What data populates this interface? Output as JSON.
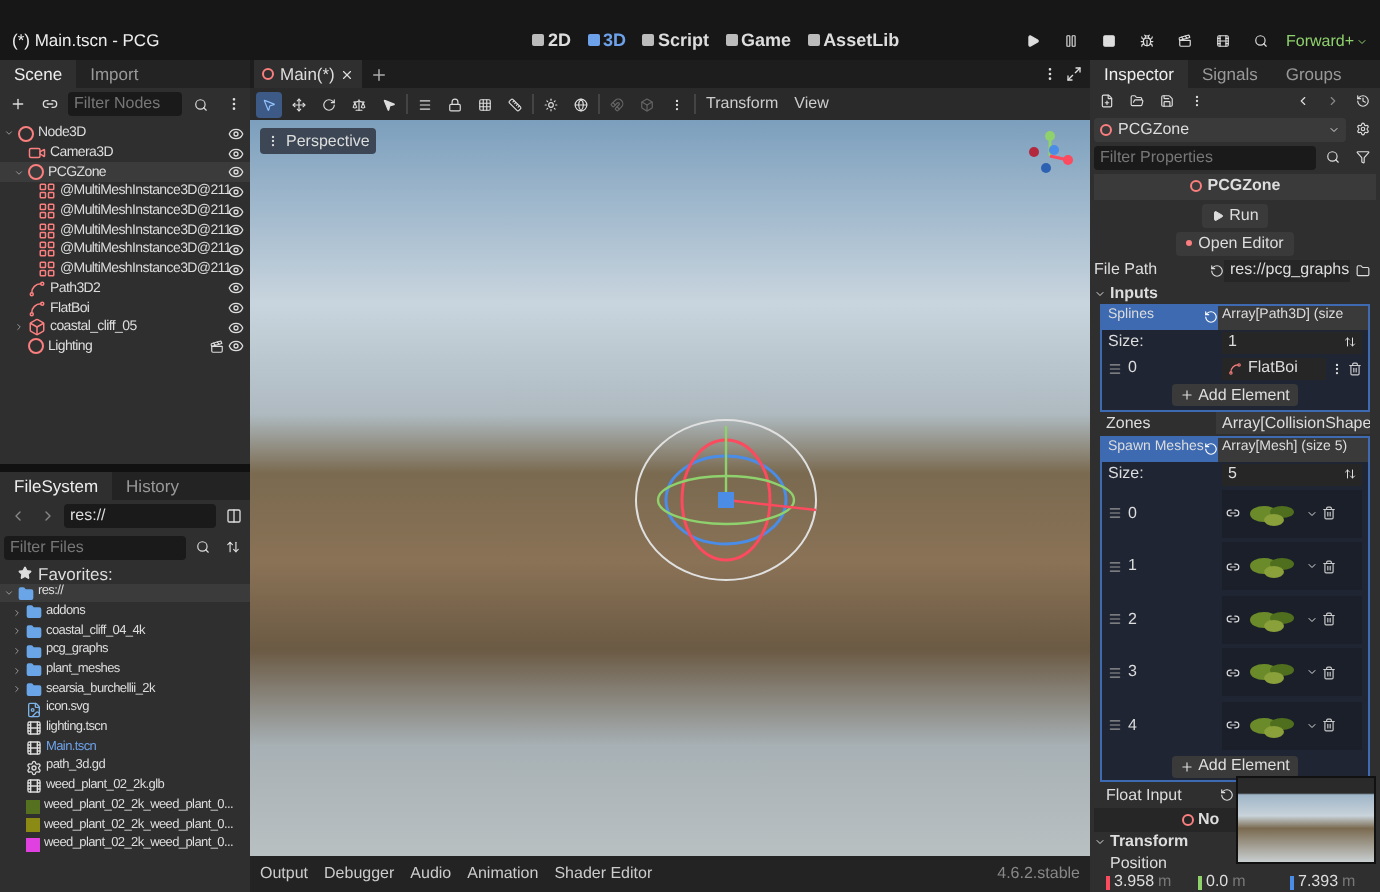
{
  "window": {
    "title": "(*) Main.tscn - PCG"
  },
  "main_screens": [
    {
      "label": "2D",
      "selected": false
    },
    {
      "label": "3D",
      "selected": true
    },
    {
      "label": "Script",
      "selected": false
    },
    {
      "label": "Game",
      "selected": false
    },
    {
      "label": "AssetLib",
      "selected": false
    }
  ],
  "renderer": "Forward+",
  "scene_dock": {
    "tabs": [
      {
        "label": "Scene",
        "selected": true
      },
      {
        "label": "Import",
        "selected": false
      }
    ],
    "filter_placeholder": "Filter Nodes",
    "tree": [
      {
        "label": "Node3D",
        "kind": "node3d",
        "selected": false,
        "expanded": true,
        "children": [
          {
            "label": "Camera3D",
            "kind": "camera",
            "selected": false
          },
          {
            "label": "PCGZone",
            "kind": "node3d",
            "selected": true,
            "expanded": true,
            "children": [
              {
                "label": "@MultiMeshInstance3D@211",
                "kind": "multimesh",
                "selected": false
              },
              {
                "label": "@MultiMeshInstance3D@211",
                "kind": "multimesh",
                "selected": false
              },
              {
                "label": "@MultiMeshInstance3D@211",
                "kind": "multimesh",
                "selected": false
              },
              {
                "label": "@MultiMeshInstance3D@211",
                "kind": "multimesh",
                "selected": false
              },
              {
                "label": "@MultiMeshInstance3D@211",
                "kind": "multimesh",
                "selected": false
              }
            ]
          },
          {
            "label": "Path3D2",
            "kind": "path",
            "selected": false
          },
          {
            "label": "FlatBoi",
            "kind": "path",
            "selected": false
          },
          {
            "label": "coastal_cliff_05",
            "kind": "mesh",
            "selected": false,
            "expanded": false
          },
          {
            "label": "Lighting",
            "kind": "lighting",
            "selected": false
          }
        ]
      }
    ]
  },
  "filesystem": {
    "tabs": [
      {
        "label": "FileSystem",
        "selected": true
      },
      {
        "label": "History",
        "selected": false
      }
    ],
    "path": "res://",
    "filter_placeholder": "Filter Files",
    "favorites": "Favorites:",
    "tree": [
      {
        "label": "res://",
        "kind": "folder",
        "selected": true,
        "expanded": true,
        "children": [
          {
            "label": "addons",
            "kind": "folder",
            "selected": false,
            "expanded": false
          },
          {
            "label": "coastal_cliff_04_4k",
            "kind": "folder",
            "selected": false,
            "expanded": false
          },
          {
            "label": "pcg_graphs",
            "kind": "folder",
            "selected": false,
            "expanded": false
          },
          {
            "label": "plant_meshes",
            "kind": "folder",
            "selected": false,
            "expanded": false
          },
          {
            "label": "searsia_burchellii_2k",
            "kind": "folder",
            "selected": false,
            "expanded": false
          },
          {
            "label": "icon.svg",
            "kind": "image",
            "selected": false
          },
          {
            "label": "lighting.tscn",
            "kind": "scene",
            "selected": false
          },
          {
            "label": "Main.tscn",
            "kind": "scene",
            "selected": false,
            "open": true
          },
          {
            "label": "path_3d.gd",
            "kind": "script",
            "selected": false
          },
          {
            "label": "weed_plant_02_2k.glb",
            "kind": "scene",
            "selected": false
          },
          {
            "label": "weed_plant_02_2k_weed_plant_0...",
            "kind": "texture",
            "color": "#55701f",
            "selected": false
          },
          {
            "label": "weed_plant_02_2k_weed_plant_0...",
            "kind": "texture",
            "color": "#8a8a14",
            "selected": false
          },
          {
            "label": "weed_plant_02_2k_weed_plant_0...",
            "kind": "texture",
            "color": "#e040e0",
            "selected": false
          }
        ]
      }
    ]
  },
  "viewport": {
    "tabs": [
      {
        "label": "Main(*)",
        "selected": true
      }
    ],
    "menus": [
      "Transform",
      "View"
    ],
    "camera_menu": "Perspective"
  },
  "bottom_panel": {
    "tabs": [
      "Output",
      "Debugger",
      "Audio",
      "Animation",
      "Shader Editor"
    ],
    "version": "4.6.2.stable"
  },
  "inspector": {
    "tabs": [
      {
        "label": "Inspector",
        "selected": true
      },
      {
        "label": "Signals",
        "selected": false
      },
      {
        "label": "Groups",
        "selected": false
      }
    ],
    "object": "PCGZone",
    "filter_placeholder": "Filter Properties",
    "header": "PCGZone",
    "run_button": "Run",
    "open_editor_button": "Open Editor",
    "file_path": {
      "label": "File Path",
      "value": "res://pcg_graphs"
    },
    "inputs_section": "Inputs",
    "splines": {
      "label": "Splines",
      "value": "Array[Path3D] (size",
      "size_label": "Size:",
      "size": "1",
      "elements": [
        {
          "index": "0",
          "value": "FlatBoi"
        }
      ],
      "add_button": "Add Element"
    },
    "zones": {
      "label": "Zones",
      "value": "Array[CollisionShape"
    },
    "spawn_meshes": {
      "label": "Spawn Meshes",
      "value": "Array[Mesh] (size 5)",
      "size_label": "Size:",
      "size": "5",
      "elements": [
        {
          "index": "0"
        },
        {
          "index": "1"
        },
        {
          "index": "2"
        },
        {
          "index": "3"
        },
        {
          "index": "4"
        }
      ],
      "add_button": "Add Element"
    },
    "float_input": {
      "label": "Float Input"
    },
    "node_button": "No",
    "transform_section": "Transform",
    "position_label": "Position",
    "position": [
      {
        "value": "3.958",
        "unit": "m"
      },
      {
        "value": "0.0",
        "unit": "m"
      },
      {
        "value": "7.393",
        "unit": "m"
      }
    ]
  }
}
